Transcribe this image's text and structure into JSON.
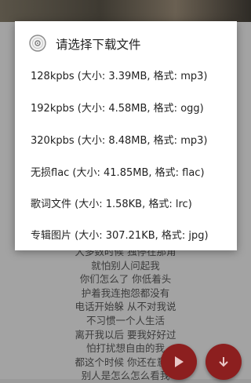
{
  "dialog": {
    "title": "请选择下载文件",
    "options": [
      {
        "label": "128kpbs (大小: 3.39MB, 格式: mp3)"
      },
      {
        "label": "192kpbs (大小: 4.58MB, 格式: ogg)"
      },
      {
        "label": "320kpbs (大小: 8.48MB, 格式: mp3)"
      },
      {
        "label": "无损flac (大小: 41.85MB, 格式: flac)"
      },
      {
        "label": "歌词文件 (大小: 1.58KB, 格式: lrc)"
      },
      {
        "label": "专辑图片 (大小: 307.21KB, 格式: jpg)"
      }
    ]
  },
  "lyrics": [
    "大多数时候 独停在那角",
    "就怕别人问起我",
    "你们怎么了 你低着头",
    "护着我连抱怨都没有",
    "电话开始躲 从不对我说",
    "不习惯一个人生活",
    "离开我以后 要我好好过",
    "怕打扰想自由的我",
    "都这个时候 你还在意着",
    "别人是怎么怎么看我"
  ],
  "icons": {
    "dialog": "disc-icon",
    "play": "play-icon",
    "download": "download-icon"
  },
  "colors": {
    "accent": "#8c1f1f"
  }
}
